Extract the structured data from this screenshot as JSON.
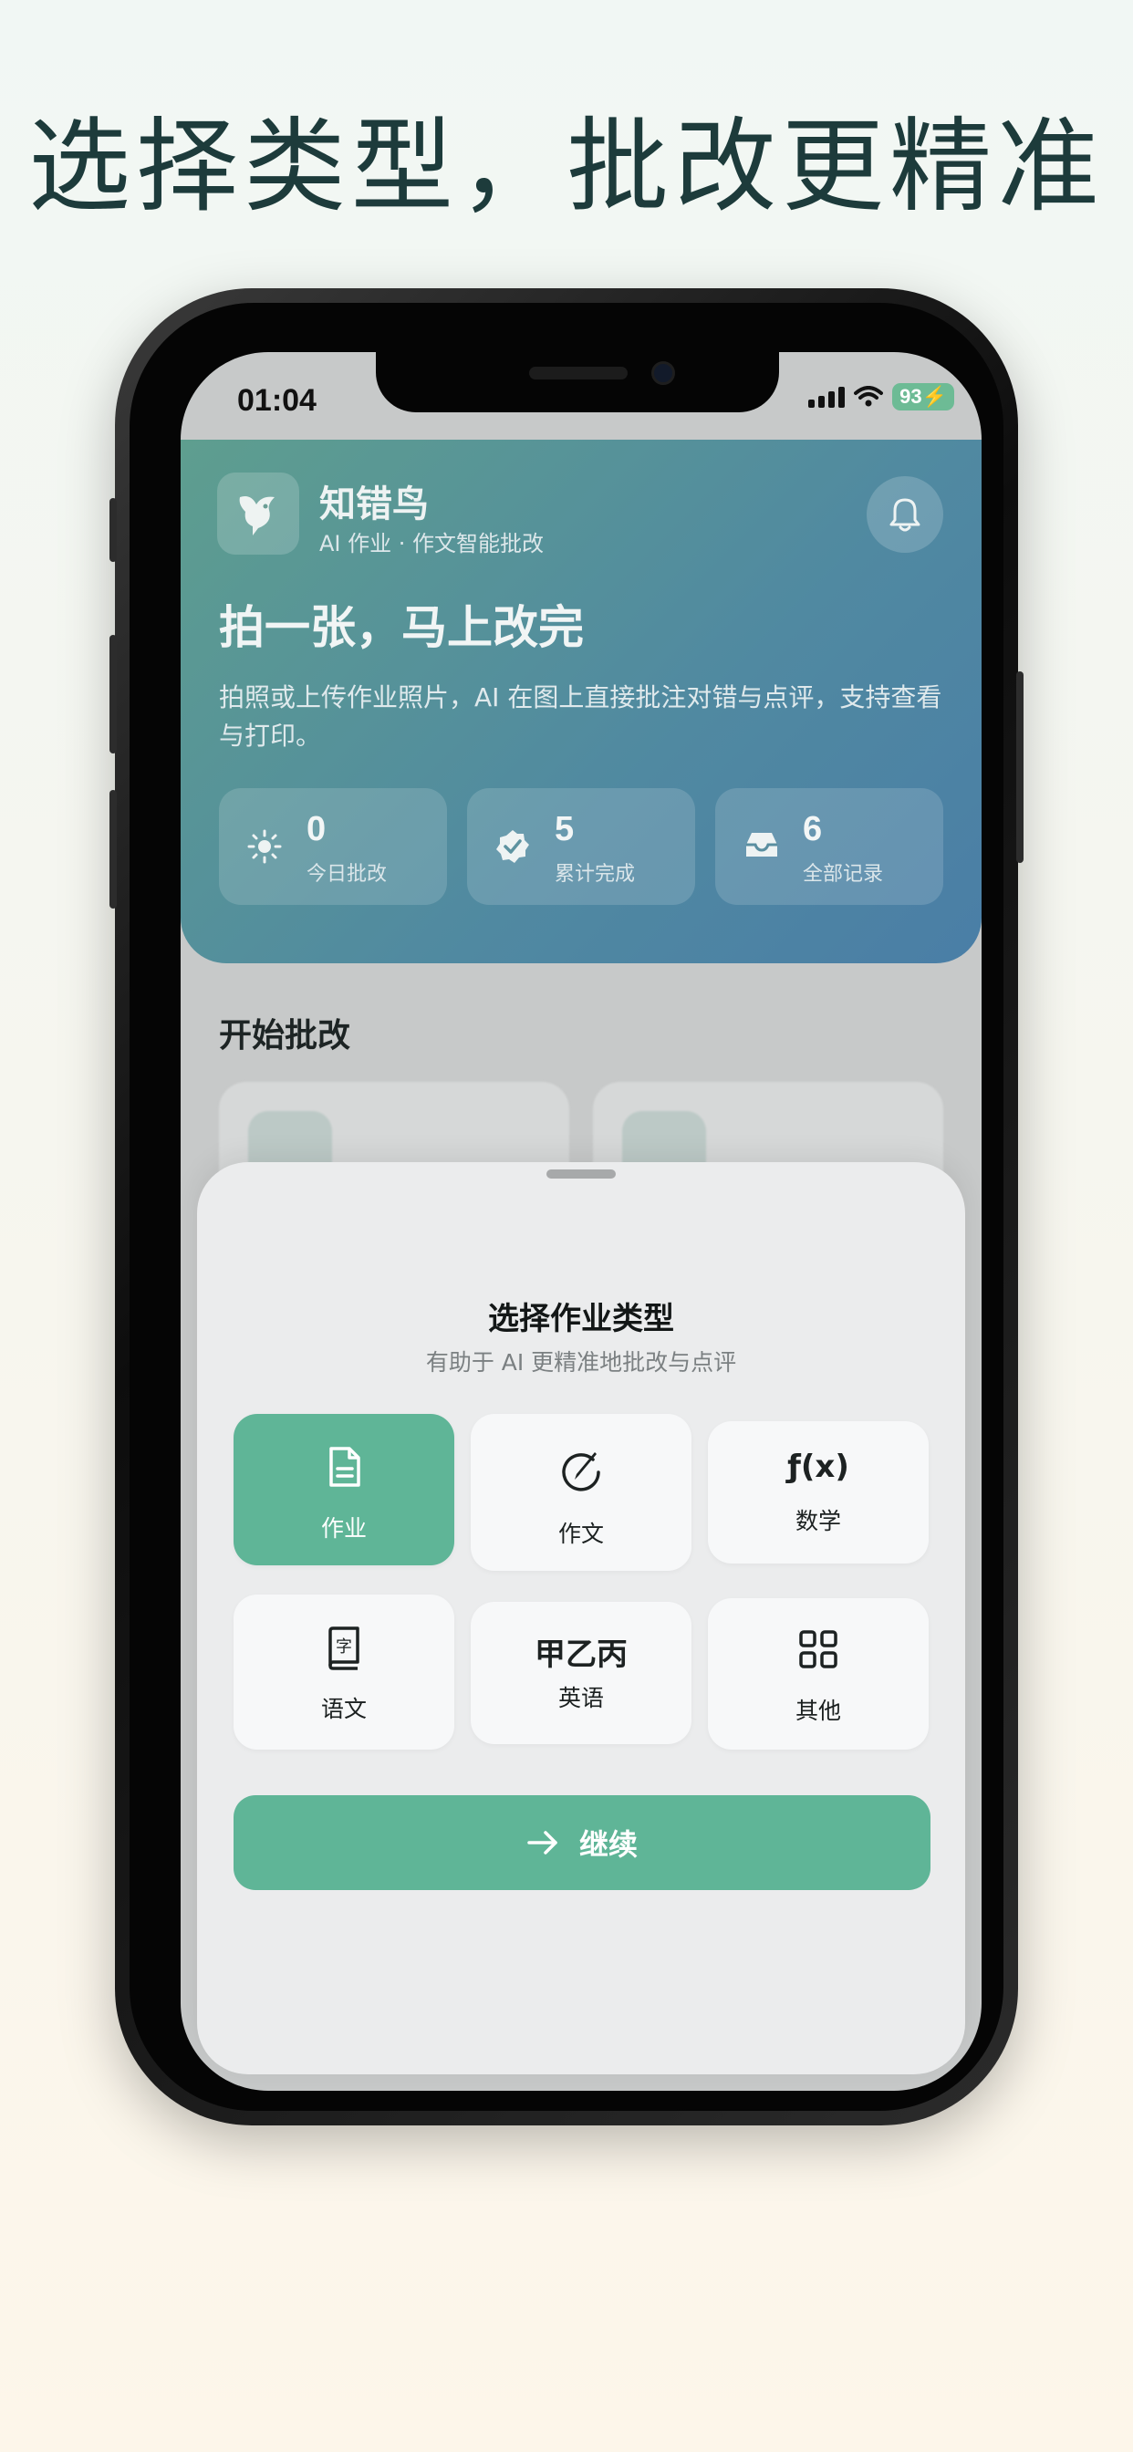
{
  "headline": "选择类型，批改更精准",
  "status_bar": {
    "time": "01:04",
    "battery": "93"
  },
  "app": {
    "name": "知错鸟",
    "subtitle": "AI 作业 · 作文智能批改",
    "hero_title": "拍一张，马上改完",
    "hero_desc": "拍照或上传作业照片，AI 在图上直接批注对错与点评，支持查看与打印。",
    "stats": [
      {
        "icon": "sun-icon",
        "value": "0",
        "label": "今日批改"
      },
      {
        "icon": "verified-badge-icon",
        "value": "5",
        "label": "累计完成"
      },
      {
        "icon": "inbox-tray-icon",
        "value": "6",
        "label": "全部记录"
      }
    ],
    "section_title": "开始批改"
  },
  "sheet": {
    "title": "选择作业类型",
    "subtitle": "有助于 AI 更精准地批改与点评",
    "types": [
      {
        "label": "作业",
        "icon": "document-icon",
        "selected": true
      },
      {
        "label": "作文",
        "icon": "pen-circle-icon",
        "selected": false
      },
      {
        "label": "数学",
        "icon": "function-icon",
        "glyph": "ƒ(x)",
        "selected": false
      },
      {
        "label": "语文",
        "icon": "dictionary-icon",
        "selected": false
      },
      {
        "label": "英语",
        "icon": "script-icon",
        "glyph": "甲乙丙",
        "selected": false
      },
      {
        "label": "其他",
        "icon": "grid-icon",
        "selected": false
      }
    ],
    "continue_label": "继续"
  },
  "colors": {
    "accent": "#5fb597",
    "hero_start": "#5e9e8f",
    "hero_end": "#4a7ea6"
  }
}
